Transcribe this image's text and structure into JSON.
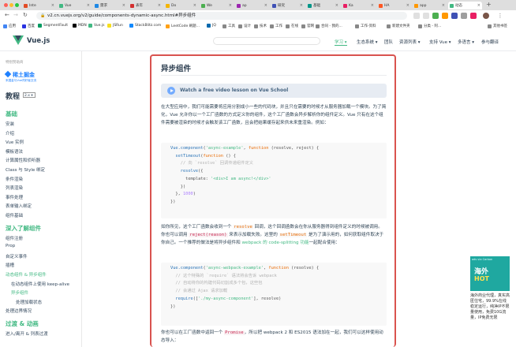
{
  "browser": {
    "tabs": [
      {
        "label": "Inte",
        "color": "#e34c26"
      },
      {
        "label": "Vue",
        "color": "#42b983"
      },
      {
        "label": "需求",
        "color": "#1e88e5"
      },
      {
        "label": "表年",
        "color": "#d32f2f"
      },
      {
        "label": "Do",
        "color": "#f4b400"
      },
      {
        "label": "We",
        "color": "#4caf50"
      },
      {
        "label": "ap",
        "color": "#9c27b0"
      },
      {
        "label": "研究",
        "color": "#3f51b5"
      },
      {
        "label": "基础",
        "color": "#009688"
      },
      {
        "label": "Ka",
        "color": "#e91e63"
      },
      {
        "label": "HA",
        "color": "#ff5722"
      },
      {
        "label": "app",
        "color": "#ff9800"
      },
      {
        "label": "动态",
        "color": "#42b983"
      }
    ],
    "new_tab": "+",
    "url": "v2.cn.vuejs.org/v2/guide/components-dynamic-async.html#异步组件",
    "bookmarks": [
      {
        "label": "应用",
        "color": "#4285f4"
      },
      {
        "label": "百度",
        "color": "#2932e1"
      },
      {
        "label": "SegmentFault",
        "color": "#009a61"
      },
      {
        "label": "MDN",
        "color": "#000000"
      },
      {
        "label": "Vue.js",
        "color": "#42b983"
      },
      {
        "label": "JSRun",
        "color": "#f7df1e"
      },
      {
        "label": "StackBlitz.com",
        "color": "#1389fd"
      },
      {
        "label": "LeetCode 刷题...",
        "color": "#ffa116"
      },
      {
        "label": "JQ",
        "color": "#0769ad"
      },
      {
        "label": "工具",
        "color": "#888888"
      },
      {
        "label": "设计",
        "color": "#888888"
      },
      {
        "label": "技术",
        "color": "#888888"
      },
      {
        "label": "工作",
        "color": "#888888"
      },
      {
        "label": "在线",
        "color": "#888888"
      },
      {
        "label": "官网",
        "color": "#888888"
      },
      {
        "label": "合同 - 我的...",
        "color": "#888888"
      },
      {
        "label": "工作-资料",
        "color": "#888888"
      },
      {
        "label": "新建文件夹",
        "color": "#888888"
      },
      {
        "label": "分类 - 阿...",
        "color": "#888888"
      },
      {
        "label": "其他书签",
        "color": "#888888"
      }
    ]
  },
  "header": {
    "brand": "Vue.js",
    "nav": [
      "学习 ▾",
      "生态系统 ▾",
      "团队",
      "资源列表 ▾",
      "支持 Vue ▾",
      "多语言 ▾",
      "参与翻译"
    ]
  },
  "sidebar": {
    "sponsor_label": "特别赞助商",
    "sponsor_name": "稀土掘金",
    "sponsor_sub": "来掘金与Vue同好者交流",
    "section_title": "教程",
    "version": "2.x",
    "items": [
      {
        "label": "基础",
        "type": "h"
      },
      {
        "label": "安装",
        "type": "item"
      },
      {
        "label": "介绍",
        "type": "item"
      },
      {
        "label": "Vue 实例",
        "type": "item"
      },
      {
        "label": "模板语法",
        "type": "item"
      },
      {
        "label": "计算属性和侦听器",
        "type": "item"
      },
      {
        "label": "Class 与 Style 绑定",
        "type": "item"
      },
      {
        "label": "条件渲染",
        "type": "item"
      },
      {
        "label": "列表渲染",
        "type": "item"
      },
      {
        "label": "事件处理",
        "type": "item"
      },
      {
        "label": "表单输入绑定",
        "type": "item"
      },
      {
        "label": "组件基础",
        "type": "item"
      },
      {
        "label": "深入了解组件",
        "type": "h"
      },
      {
        "label": "组件注册",
        "type": "item"
      },
      {
        "label": "Prop",
        "type": "item"
      },
      {
        "label": "自定义事件",
        "type": "item"
      },
      {
        "label": "插槽",
        "type": "item"
      },
      {
        "label": "动态组件 & 异步组件",
        "type": "active"
      },
      {
        "label": "在动态组件上使用 keep-alive",
        "type": "sub"
      },
      {
        "label": "异步组件",
        "type": "subactive"
      },
      {
        "label": "处理加载状态",
        "type": "sub2"
      },
      {
        "label": "处理边界情况",
        "type": "item"
      },
      {
        "label": "过渡 & 动画",
        "type": "h"
      },
      {
        "label": "进入/离开 & 列表过渡",
        "type": "item"
      }
    ]
  },
  "main": {
    "title": "异步组件",
    "video_banner": "Watch a free video lesson on Vue School",
    "para1": "在大型应用中，我们可能需要将应用分割成小一些的代码块，并且只在需要的时候才从服务器加载一个模块。为了简化，Vue 允许你以一个工厂函数的方式定义你的组件，这个工厂函数会异步解析你的组件定义。Vue 只有在这个组件需要被渲染的时候才会触发该工厂函数，且会把结果缓存起来供未来重渲染。例如：",
    "para2_parts": {
      "a": "如你所见，这个工厂函数会收到一个 ",
      "resolve": "resolve",
      "b": " 回调，这个回调函数会在你从服务器得到组件定义的时候被调用。你也可以调用 ",
      "reject": "reject(reason)",
      "c": " 来表示加载失败。这里的 ",
      "settimeout": "setTimeout",
      "d": " 是为了演示用的，如何获取组件取决于你自己。一个推荐的做法是将异步组件和 ",
      "webpack": "webpack 的 code-splitting 功能",
      "e": "一起配合使用："
    },
    "para3_parts": {
      "a": "你也可以在工厂函数中返回一个 ",
      "promise": "Promise",
      "b": "，所以把 webpack 2 和 ES2015 语法加在一起，我们可以这样使用动态导入："
    }
  },
  "ad": {
    "tag": "ads via Carbon",
    "big1": "海外",
    "big2": "HOT",
    "text": "海外商业代理，真实高匿住宅，99.9%在线稳定运行，纯净IP不限量使用，免费10G流量，IP免费无限"
  }
}
